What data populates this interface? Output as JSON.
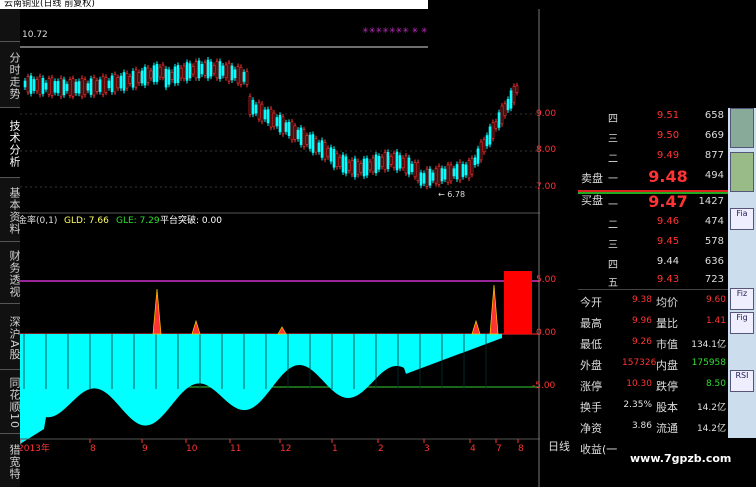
{
  "window": {
    "title": "云南铜业(日线 前复权)",
    "price_readout": "10.72"
  },
  "tabs": [
    "分时走势",
    "技术分析",
    "基本资料",
    "财务透视",
    "深沪A股",
    "同花顺10",
    "猎宽特"
  ],
  "indicator": {
    "name": "金率(0,1)",
    "gld": "GLD: 7.66",
    "gle": "GLE: 7.29",
    "signal": "平台突破: 0.00"
  },
  "price_axis": [
    "9.00",
    "8.00",
    "7.00"
  ],
  "indicator_axis": [
    "5.00",
    "0.00",
    "-5.00"
  ],
  "low_marker": "6.78",
  "x_axis": [
    "2013年",
    "8",
    "9",
    "10",
    "11",
    "12",
    "1",
    "2",
    "3",
    "4",
    "7",
    "8"
  ],
  "period": "日线",
  "order_book": {
    "sell": [
      {
        "level": "四",
        "price": "9.51",
        "volume": "658"
      },
      {
        "level": "三",
        "price": "9.50",
        "volume": "669"
      },
      {
        "level": "二",
        "price": "9.49",
        "volume": "877"
      },
      {
        "level": "一",
        "price": "9.48",
        "volume": "494"
      }
    ],
    "buy": [
      {
        "level": "一",
        "price": "9.47",
        "volume": "1427"
      },
      {
        "level": "二",
        "price": "9.46",
        "volume": "474"
      },
      {
        "level": "三",
        "price": "9.45",
        "volume": "578"
      },
      {
        "level": "四",
        "price": "9.44",
        "volume": "636"
      },
      {
        "level": "五",
        "price": "9.43",
        "volume": "723"
      }
    ],
    "sell_label": "卖盘",
    "buy_label": "买盘"
  },
  "stats": [
    {
      "k1": "今开",
      "v1": "9.38",
      "k2": "均价",
      "v2": "9.60"
    },
    {
      "k1": "最高",
      "v1": "9.96",
      "k2": "量比",
      "v2": "1.41"
    },
    {
      "k1": "最低",
      "v1": "9.26",
      "k2": "市值",
      "v2": "134.1亿"
    },
    {
      "k1": "外盘",
      "v1": "157326",
      "k2": "内盘",
      "v2": "175958"
    },
    {
      "k1": "涨停",
      "v1": "10.30",
      "k2": "跌停",
      "v2": "8.50"
    },
    {
      "k1": "换手",
      "v1": "2.35%",
      "k2": "股本",
      "v2": "14.2亿"
    },
    {
      "k1": "净资",
      "v1": "3.86",
      "k2": "流通",
      "v2": "14.2亿"
    },
    {
      "k1": "收益(一",
      "v1": "",
      "k2": "",
      "v2": ""
    }
  ],
  "thumbs": [
    "Fia",
    "Fiz",
    "Fig",
    "RSI"
  ],
  "watermark": "www.7gpzb.com",
  "colors": {
    "up": "#ff3333",
    "down": "#33dd33",
    "cyan": "#00ffff",
    "magenta": "#cc33cc"
  }
}
